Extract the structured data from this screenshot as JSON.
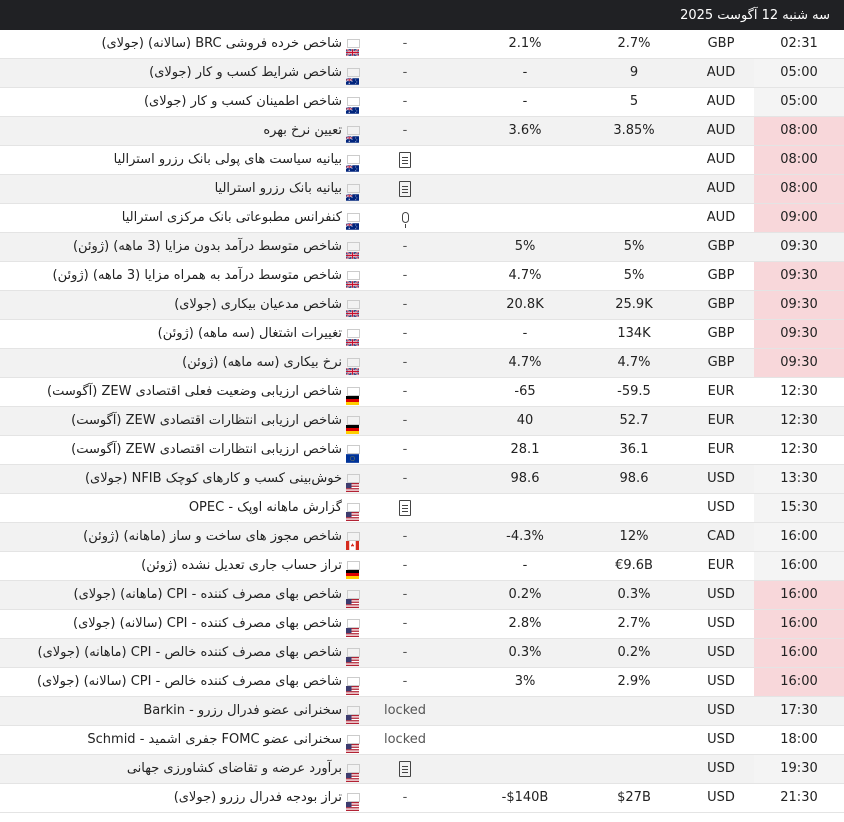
{
  "header": {
    "date": "سه شنبه 12 آگوست 2025"
  },
  "colors": {
    "low": "#f4f4f4",
    "medium": "#fdf3c9",
    "high": "#f8d7da"
  },
  "rows": [
    {
      "time": "02:31",
      "importance": "medium",
      "currency": "GBP",
      "forecast": "2.7%",
      "actual": "2.1%",
      "marker": "-",
      "marker_type": "text",
      "flag": "uk-flag-icon",
      "event": "شاخص خرده فروشی BRC (سالانه) (جولای)"
    },
    {
      "time": "05:00",
      "importance": "low",
      "currency": "AUD",
      "forecast": "9",
      "actual": "-",
      "marker": "-",
      "marker_type": "text",
      "flag": "australia-flag-icon",
      "event": "شاخص شرایط کسب و کار (جولای)"
    },
    {
      "time": "05:00",
      "importance": "low",
      "currency": "AUD",
      "forecast": "5",
      "actual": "-",
      "marker": "-",
      "marker_type": "text",
      "flag": "australia-flag-icon",
      "event": "شاخص اطمینان کسب و کار (جولای)"
    },
    {
      "time": "08:00",
      "importance": "high",
      "currency": "AUD",
      "forecast": "3.85%",
      "actual": "3.6%",
      "marker": "-",
      "marker_type": "text",
      "flag": "australia-flag-icon",
      "event": "تعیین نرخ بهره"
    },
    {
      "time": "08:00",
      "importance": "high",
      "currency": "AUD",
      "forecast": "",
      "actual": "",
      "marker": "",
      "marker_type": "document",
      "flag": "australia-flag-icon",
      "event": "بیانیه سیاست های پولی بانک رزرو استرالیا"
    },
    {
      "time": "08:00",
      "importance": "high",
      "currency": "AUD",
      "forecast": "",
      "actual": "",
      "marker": "",
      "marker_type": "document",
      "flag": "australia-flag-icon",
      "event": "بیانیه بانک رزرو استرالیا"
    },
    {
      "time": "09:00",
      "importance": "high",
      "currency": "AUD",
      "forecast": "",
      "actual": "",
      "marker": "",
      "marker_type": "microphone",
      "flag": "australia-flag-icon",
      "event": "کنفرانس مطبوعاتی بانک مرکزی استرالیا"
    },
    {
      "time": "09:30",
      "importance": "medium",
      "currency": "GBP",
      "forecast": "5%",
      "actual": "5%",
      "marker": "-",
      "marker_type": "text",
      "flag": "uk-flag-icon",
      "event": "شاخص متوسط درآمد بدون مزایا (3 ماهه) (ژوئن)"
    },
    {
      "time": "09:30",
      "importance": "high",
      "currency": "GBP",
      "forecast": "5%",
      "actual": "4.7%",
      "marker": "-",
      "marker_type": "text",
      "flag": "uk-flag-icon",
      "event": "شاخص متوسط درآمد به همراه مزایا (3 ماهه) (ژوئن)"
    },
    {
      "time": "09:30",
      "importance": "high",
      "currency": "GBP",
      "forecast": "25.9K",
      "actual": "20.8K",
      "marker": "-",
      "marker_type": "text",
      "flag": "uk-flag-icon",
      "event": "شاخص مدعیان بیکاری (جولای)"
    },
    {
      "time": "09:30",
      "importance": "high",
      "currency": "GBP",
      "forecast": "134K",
      "actual": "-",
      "marker": "-",
      "marker_type": "text",
      "flag": "uk-flag-icon",
      "event": "تغییرات اشتغال (سه ماهه) (ژوئن)"
    },
    {
      "time": "09:30",
      "importance": "high",
      "currency": "GBP",
      "forecast": "4.7%",
      "actual": "4.7%",
      "marker": "-",
      "marker_type": "text",
      "flag": "uk-flag-icon",
      "event": "نرخ بیکاری (سه ماهه) (ژوئن)"
    },
    {
      "time": "12:30",
      "importance": "medium",
      "currency": "EUR",
      "forecast": "-59.5",
      "actual": "-65",
      "marker": "-",
      "marker_type": "text",
      "flag": "germany-flag-icon",
      "event": "شاخص ارزیابی وضعیت فعلی اقتصادی ZEW (آگوست)"
    },
    {
      "time": "12:30",
      "importance": "medium",
      "currency": "EUR",
      "forecast": "52.7",
      "actual": "40",
      "marker": "-",
      "marker_type": "text",
      "flag": "germany-flag-icon",
      "event": "شاخص ارزیابی انتظارات اقتصادی ZEW (آگوست)"
    },
    {
      "time": "12:30",
      "importance": "medium",
      "currency": "EUR",
      "forecast": "36.1",
      "actual": "28.1",
      "marker": "-",
      "marker_type": "text",
      "flag": "eu-flag-icon",
      "event": "شاخص ارزیابی انتظارات اقتصادی ZEW (آگوست)"
    },
    {
      "time": "13:30",
      "importance": "low",
      "currency": "USD",
      "forecast": "98.6",
      "actual": "98.6",
      "marker": "-",
      "marker_type": "text",
      "flag": "us-flag-icon",
      "event": "خوش‌بینی کسب و کارهای کوچک  NFIB (جولای)"
    },
    {
      "time": "15:30",
      "importance": "low",
      "currency": "USD",
      "forecast": "",
      "actual": "",
      "marker": "",
      "marker_type": "document",
      "flag": "us-flag-icon",
      "event": "گزارش ماهانه اوپک - OPEC"
    },
    {
      "time": "16:00",
      "importance": "low",
      "currency": "CAD",
      "forecast": "12%",
      "actual": "-4.3%",
      "marker": "-",
      "marker_type": "text",
      "flag": "canada-flag-icon",
      "event": "شاخص مجوز های ساخت و ساز (ماهانه) (ژوئن)"
    },
    {
      "time": "16:00",
      "importance": "low",
      "currency": "EUR",
      "forecast": "€9.6B",
      "actual": "-",
      "marker": "-",
      "marker_type": "text",
      "flag": "germany-flag-icon",
      "event": "تراز حساب جاری تعدیل نشده (ژوئن)"
    },
    {
      "time": "16:00",
      "importance": "high",
      "currency": "USD",
      "forecast": "0.3%",
      "actual": "0.2%",
      "marker": "-",
      "marker_type": "text",
      "flag": "us-flag-icon",
      "event": "شاخص بهای مصرف کننده - CPI (ماهانه) (جولای)"
    },
    {
      "time": "16:00",
      "importance": "high",
      "currency": "USD",
      "forecast": "2.7%",
      "actual": "2.8%",
      "marker": "-",
      "marker_type": "text",
      "flag": "us-flag-icon",
      "event": "شاخص بهای مصرف کننده - CPI (سالانه) (جولای)"
    },
    {
      "time": "16:00",
      "importance": "high",
      "currency": "USD",
      "forecast": "0.2%",
      "actual": "0.3%",
      "marker": "-",
      "marker_type": "text",
      "flag": "us-flag-icon",
      "event": "شاخص بهای مصرف کننده خالص - CPI (ماهانه) (جولای)"
    },
    {
      "time": "16:00",
      "importance": "high",
      "currency": "USD",
      "forecast": "2.9%",
      "actual": "3%",
      "marker": "-",
      "marker_type": "text",
      "flag": "us-flag-icon",
      "event": "شاخص بهای مصرف کننده خالص - CPI (سالانه) (جولای)"
    },
    {
      "time": "17:30",
      "importance": "medium",
      "currency": "USD",
      "forecast": "",
      "actual": "",
      "marker": "locked",
      "marker_type": "text",
      "flag": "us-flag-icon",
      "event": "سخنرانی عضو فدرال رزرو - Barkin"
    },
    {
      "time": "18:00",
      "importance": "medium",
      "currency": "USD",
      "forecast": "",
      "actual": "",
      "marker": "locked",
      "marker_type": "text",
      "flag": "us-flag-icon",
      "event": "سخنرانی عضو FOMC جفری اشمید - Schmid"
    },
    {
      "time": "19:30",
      "importance": "low",
      "currency": "USD",
      "forecast": "",
      "actual": "",
      "marker": "",
      "marker_type": "document",
      "flag": "us-flag-icon",
      "event": "برآورد عرضه و تقاضای کشاورزی جهانی"
    },
    {
      "time": "21:30",
      "importance": "medium",
      "currency": "USD",
      "forecast": "$27B",
      "actual": "-$140B",
      "marker": "-",
      "marker_type": "text",
      "flag": "us-flag-icon",
      "event": "تراز بودجه فدرال رزرو (جولای)"
    }
  ]
}
